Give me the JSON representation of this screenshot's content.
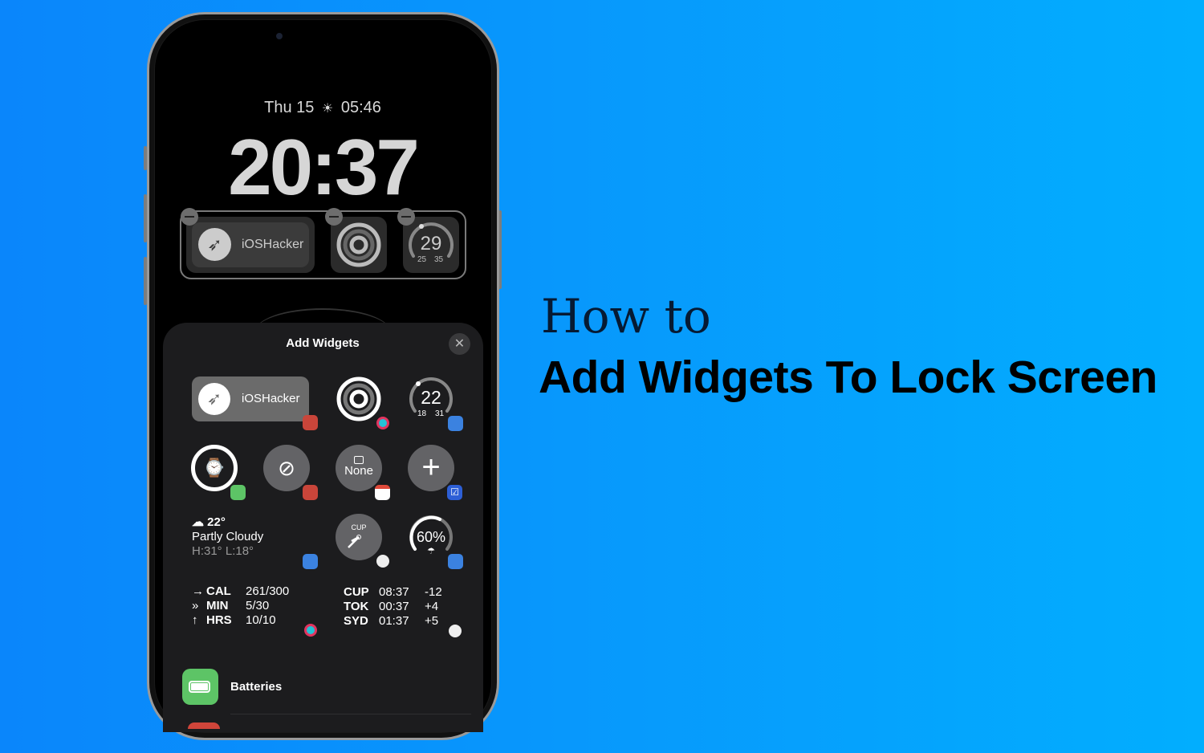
{
  "headline": {
    "line1": "How to",
    "line2": "Add Widgets To Lock Screen"
  },
  "lock_screen": {
    "date": "Thu 15",
    "sunrise_time": "05:46",
    "time": "20:37",
    "widgets": [
      {
        "type": "app-link",
        "label": "iOSHacker",
        "icon": "compass-icon"
      },
      {
        "type": "activity-rings",
        "icon": "activity-rings-icon"
      },
      {
        "type": "temperature-gauge",
        "value": "29",
        "low": "25",
        "high": "35"
      }
    ]
  },
  "sheet": {
    "title": "Add Widgets",
    "close_icon": "close-icon",
    "suggestions": {
      "app_link": {
        "label": "iOSHacker"
      },
      "temperature": {
        "value": "22",
        "low": "18",
        "high": "31"
      },
      "calendar": {
        "label": "None"
      },
      "weather": {
        "temp": "22°",
        "condition": "Partly Cloudy",
        "range": "H:31° L:18°"
      },
      "clock": {
        "city": "CUP"
      },
      "rain": {
        "value": "60%"
      },
      "activity": [
        {
          "metric": "CAL",
          "value": "261/300"
        },
        {
          "metric": "MIN",
          "value": "5/30"
        },
        {
          "metric": "HRS",
          "value": "10/10"
        }
      ],
      "world_clock": [
        {
          "city": "CUP",
          "time": "08:37",
          "offset": "-12"
        },
        {
          "city": "TOK",
          "time": "00:37",
          "offset": "+4"
        },
        {
          "city": "SYD",
          "time": "01:37",
          "offset": "+5"
        }
      ]
    },
    "apps": [
      {
        "label": "Batteries",
        "icon": "battery-icon"
      }
    ]
  },
  "colors": {
    "background_start": "#0a86fb",
    "background_end": "#02aefe",
    "sheet": "#1c1c1e",
    "batteries_green": "#5dc466"
  }
}
